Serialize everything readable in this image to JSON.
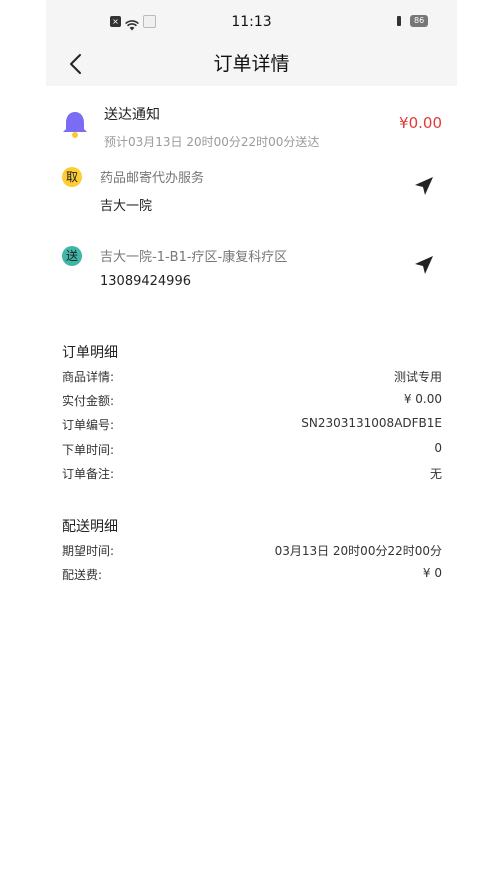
{
  "status_bar": {
    "time": "11:13",
    "battery": "86",
    "icons": [
      "sim-off-icon",
      "wifi-icon",
      "notification-box-icon",
      "vibrate-icon",
      "battery-icon"
    ]
  },
  "header": {
    "title": "订单详情",
    "back_icon": "chevron-left-icon"
  },
  "notice": {
    "icon": "bell-icon",
    "title": "送达通知",
    "subtitle": "预计03月13日 20时00分22时00分送达",
    "amount": "¥0.00",
    "colors": {
      "bell": "#7b6cf6",
      "clapper": "#ffc531",
      "amount": "#e23a3a"
    }
  },
  "pickup": {
    "badge": "取",
    "label": "药品邮寄代办服务",
    "place": "吉大一院",
    "badge_color": "#ffcc33",
    "nav_icon": "navigation-arrow-icon"
  },
  "delivery": {
    "badge": "送",
    "label": "吉大一院-1-B1-疗区-康复科疗区",
    "phone": "13089424996",
    "badge_color": "#3fb6a8",
    "nav_icon": "navigation-arrow-icon"
  },
  "order_detail": {
    "title": "订单明细",
    "rows": [
      {
        "k": "商品详情:",
        "v": "测试专用"
      },
      {
        "k": "实付金额:",
        "v": "¥ 0.00"
      },
      {
        "k": "订单编号:",
        "v": "SN2303131008ADFB1E"
      },
      {
        "k": "下单时间:",
        "v": "0"
      },
      {
        "k": "订单备注:",
        "v": "无"
      }
    ]
  },
  "delivery_detail": {
    "title": "配送明细",
    "rows": [
      {
        "k": "期望时间:",
        "v": "03月13日 20时00分22时00分"
      },
      {
        "k": "配送费:",
        "v": "¥ 0"
      }
    ]
  }
}
